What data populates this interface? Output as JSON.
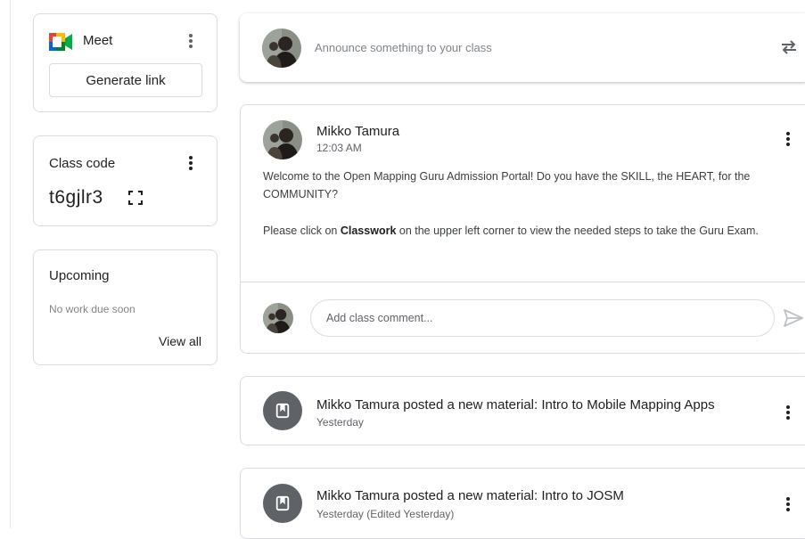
{
  "meet": {
    "title": "Meet",
    "generate_link": "Generate link"
  },
  "class_code": {
    "label": "Class code",
    "value": "t6gjlr3"
  },
  "upcoming": {
    "title": "Upcoming",
    "empty_text": "No work due soon",
    "view_all": "View all"
  },
  "announce": {
    "placeholder": "Announce something to your class"
  },
  "post": {
    "author": "Mikko Tamura",
    "time": "12:03 AM",
    "body_line1": "Welcome to the Open Mapping Guru Admission Portal! Do you have the SKILL, the HEART, for the COMMUNITY?",
    "body_line2_pre": "Please click on ",
    "body_line2_bold": "Classwork",
    "body_line2_post": " on the upper left corner to view the needed steps to take the Guru Exam.",
    "comment_placeholder": "Add class comment..."
  },
  "materials": [
    {
      "title": "Mikko Tamura posted a new material: Intro to Mobile Mapping Apps",
      "time": "Yesterday"
    },
    {
      "title": "Mikko Tamura posted a new material: Intro to JOSM",
      "time": "Yesterday (Edited Yesterday)"
    }
  ],
  "colors": {
    "border": "#dadce0",
    "text": "#202124",
    "muted": "#5f6368",
    "meet_green": "#00832d",
    "meet_blue": "#0066da",
    "meet_yellow": "#ffba00",
    "meet_red": "#e94235"
  }
}
